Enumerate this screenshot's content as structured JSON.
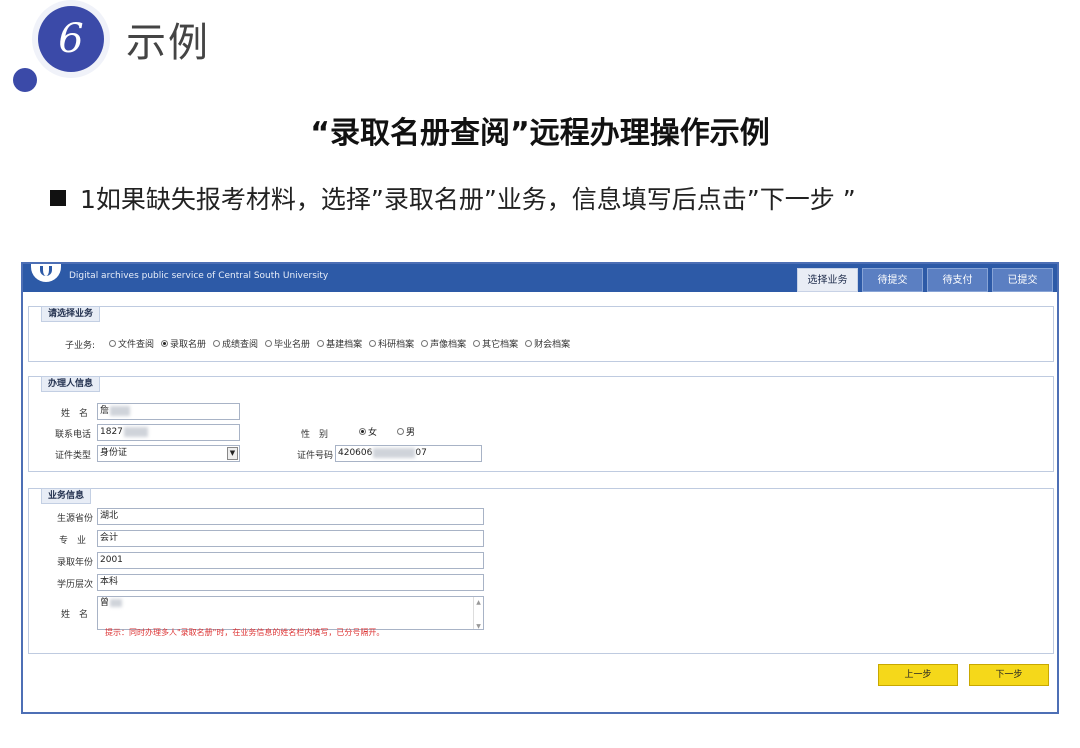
{
  "slide": {
    "number": "6",
    "title": "示例",
    "subtitle": "“录取名册查阅”远程办理操作示例",
    "bullet": "1如果缺失报考材料，选择”录取名册”业务，信息填写后点击”下一步 ”"
  },
  "app": {
    "org_text": "Digital archives public service of Central South University",
    "tabs": [
      "选择业务",
      "待提交",
      "待支付",
      "已提交"
    ],
    "active_tab": "选择业务",
    "select_business": {
      "title": "请选择业务",
      "sub_label": "子业务:",
      "options": [
        "文件查阅",
        "录取名册",
        "成绩查阅",
        "毕业名册",
        "基建档案",
        "科研档案",
        "声像档案",
        "其它档案",
        "财会档案"
      ],
      "selected": "录取名册"
    },
    "applicant": {
      "title": "办理人信息",
      "name_label": "姓　名",
      "name_value": "詹",
      "phone_label": "联系电话",
      "phone_value": "1827",
      "gender_label": "性　别",
      "gender_options": [
        "女",
        "男"
      ],
      "gender_selected": "女",
      "id_type_label": "证件类型",
      "id_type_value": "身份证",
      "id_number_label": "证件号码",
      "id_number_value": "420606",
      "id_number_suffix": "07"
    },
    "business_info": {
      "title": "业务信息",
      "province_label": "生源省份",
      "province_value": "湖北",
      "major_label": "专　业",
      "major_value": "会计",
      "year_label": "录取年份",
      "year_value": "2001",
      "level_label": "学历层次",
      "level_value": "本科",
      "names_label": "姓　名",
      "names_value": "曾",
      "hint": "提示：同时办理多人\"录取名册\"时，在业务信息的姓名栏内填写，已分号隔开。"
    },
    "buttons": {
      "prev": "上一步",
      "next": "下一步"
    }
  },
  "colors": {
    "accent": "#3b4aa8",
    "header_blue": "#2d5aa7",
    "button_yellow": "#f5d81a",
    "hint_red": "#dd3333"
  }
}
